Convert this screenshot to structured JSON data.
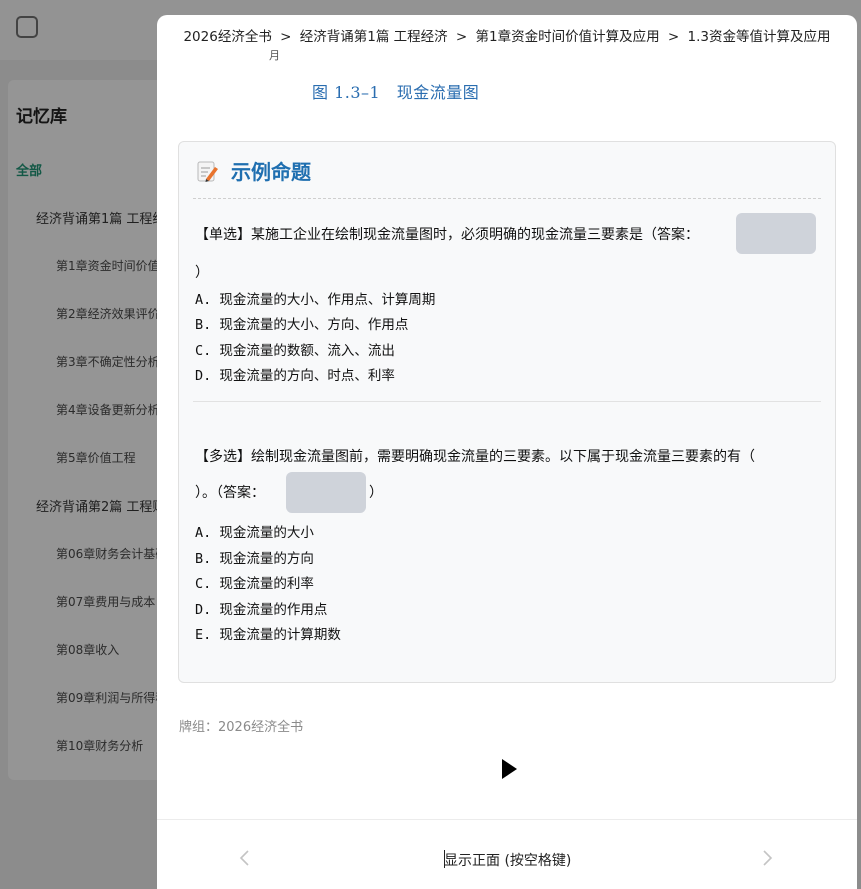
{
  "background": {
    "sidebar_title": "记忆库",
    "all_label": "全部",
    "tree": [
      {
        "label": "经济背诵第1篇 工程经济",
        "level": 1
      },
      {
        "label": "第1章资金时间价值计算及应用",
        "level": 2
      },
      {
        "label": "第2章经济效果评价",
        "level": 2
      },
      {
        "label": "第3章不确定性分析",
        "level": 2
      },
      {
        "label": "第4章设备更新分析",
        "level": 2
      },
      {
        "label": "第5章价值工程",
        "level": 2
      },
      {
        "label": "经济背诵第2篇 工程财务",
        "level": 1
      },
      {
        "label": "第06章财务会计基础",
        "level": 2
      },
      {
        "label": "第07章费用与成本",
        "level": 2
      },
      {
        "label": "第08章收入",
        "level": 2
      },
      {
        "label": "第09章利润与所得税",
        "level": 2
      },
      {
        "label": "第10章财务分析",
        "level": 2
      }
    ]
  },
  "breadcrumb": {
    "items": [
      "2026经济全书",
      "经济背诵第1篇 工程经济",
      "第1章资金时间价值计算及应用",
      "1.3资金等值计算及应用"
    ],
    "separator": ">"
  },
  "figure": {
    "fragment": "月",
    "caption": "图 1.3–1　现金流量图"
  },
  "card": {
    "icon": "memo-icon",
    "title": "示例命题",
    "single": {
      "line1": "【单选】某施工企业在绘制现金流量图时，必须明确的现金流量三要素是（答案：",
      "line2": "）",
      "options": [
        "A. 现金流量的大小、作用点、计算周期",
        "B. 现金流量的大小、方向、作用点",
        "C. 现金流量的数额、流入、流出",
        "D. 现金流量的方向、时点、利率"
      ]
    },
    "multi": {
      "line1": "【多选】绘制现金流量图前，需要明确现金流量的三要素。以下属于现金流量三要素的有（",
      "line2_prefix": "）。（答案：",
      "line2_suffix": "）",
      "options": [
        "A. 现金流量的大小",
        "B. 现金流量的方向",
        "C. 现金流量的利率",
        "D. 现金流量的作用点",
        "E. 现金流量的计算期数"
      ]
    }
  },
  "deck_label": "牌组：2026经济全书",
  "footer": {
    "show_front": "显示正面 (按空格键)"
  },
  "colors": {
    "accent_title": "#1f6fb0",
    "all_green": "#1e8a6e",
    "blank": "#cfd3da"
  }
}
